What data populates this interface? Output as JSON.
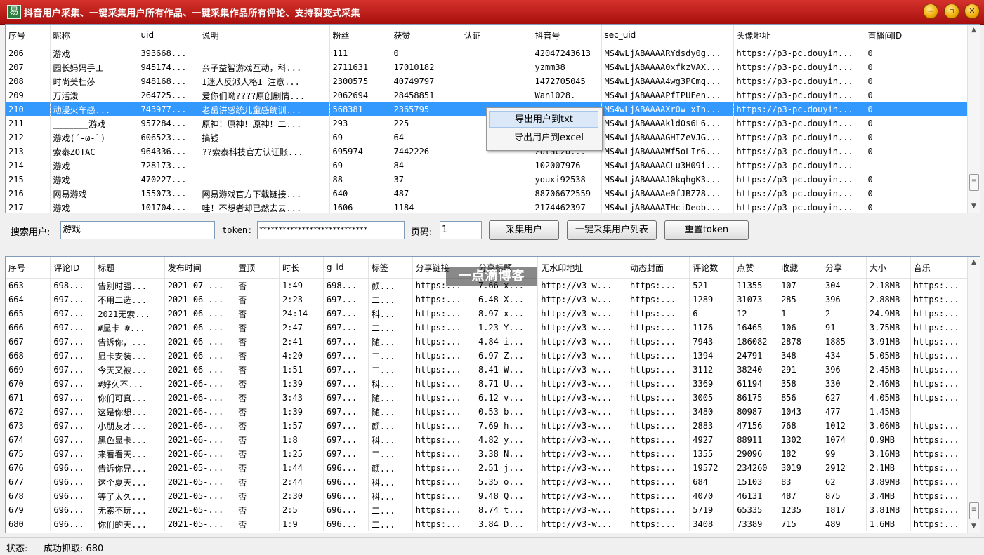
{
  "window": {
    "title": "抖音用户采集、一键采集用户所有作品、一键采集作品所有评论、支持裂变式采集",
    "icon": "app-icon"
  },
  "user_table": {
    "columns": [
      "序号",
      "昵称",
      "uid",
      "说明",
      "粉丝",
      "获赞",
      "认证",
      "抖音号",
      "sec_uid",
      "头像地址",
      "直播间ID"
    ],
    "rows": [
      [
        "206",
        "游戏",
        "393668...",
        "",
        "111",
        "0",
        "",
        "42047243613",
        "MS4wLjABAAAARYdsdy0g...",
        "https://p3-pc.douyin...",
        "0"
      ],
      [
        "207",
        "园长妈妈手工",
        "945174...",
        "亲子益智游戏互动，科...",
        "2711631",
        "17010182",
        "",
        "yzmm38",
        "MS4wLjABAAAA0xfkzVAX...",
        "https://p3-pc.douyin...",
        "0"
      ],
      [
        "208",
        "时尚美杜莎",
        "948168...",
        "I迷人反派人格I  注意...",
        "2300575",
        "40749797",
        "",
        "1472705045",
        "MS4wLjABAAAA4wg3PCmq...",
        "https://p3-pc.douyin...",
        "0"
      ],
      [
        "209",
        "万活泼",
        "264725...",
        "爱你们呦????原创剧情...",
        "2062694",
        "28458851",
        "",
        "Wan1028.",
        "MS4wLjABAAAAPfIPUFen...",
        "https://p3-pc.douyin...",
        "0"
      ],
      [
        "210",
        "动漫火车感...",
        "743977...",
        "老岳讲感统儿童感统训...",
        "568381",
        "2365795",
        "",
        "",
        "MS4wLjABAAAAXr0w_xIh...",
        "https://p3-pc.douyin...",
        "0"
      ],
      [
        "211",
        "_______游戏",
        "957284...",
        "原神！原神！原神！二...",
        "293",
        "225",
        "",
        "",
        "MS4wLjABAAAAkld0s6L6...",
        "https://p3-pc.douyin...",
        "0"
      ],
      [
        "212",
        "游戏(´-ω-`)",
        "606523...",
        "搞钱",
        "69",
        "64",
        "",
        "",
        "MS4wLjABAAAAGHIZeVJG...",
        "https://p3-pc.douyin...",
        "0"
      ],
      [
        "213",
        "索泰ZOTAC",
        "964336...",
        "??索泰科技官方认证账...",
        "695974",
        "7442226",
        "",
        "zotaczo...",
        "MS4wLjABAAAAWf5oLIr6...",
        "https://p3-pc.douyin...",
        "0"
      ],
      [
        "214",
        "游戏",
        "728173...",
        "",
        "69",
        "84",
        "",
        "102007976",
        "MS4wLjABAAAACLu3H09i...",
        "https://p3-pc.douyin...",
        ""
      ],
      [
        "215",
        "游戏",
        "470227...",
        "",
        "88",
        "37",
        "",
        "youxi92538",
        "MS4wLjABAAAAJ0kqhgK3...",
        "https://p3-pc.douyin...",
        "0"
      ],
      [
        "216",
        "网易游戏",
        "155073...",
        "网易游戏官方下载链接...",
        "640",
        "487",
        "",
        "88706672559",
        "MS4wLjABAAAAe0fJBZ78...",
        "https://p3-pc.douyin...",
        "0"
      ],
      [
        "217",
        "游戏",
        "101704...",
        "哇！不想者却已然去去...",
        "1606",
        "1184",
        "",
        "2174462397",
        "MS4wLjABAAAATHciDeob...",
        "https://p3-pc.douyin...",
        "0"
      ]
    ],
    "selected_row": 4
  },
  "context_menu": {
    "items": [
      "导出用户到txt",
      "导出用户到excel"
    ]
  },
  "search": {
    "user_label": "搜索用户:",
    "user_value": "游戏",
    "token_label": "token:",
    "token_value": "****************************",
    "page_label": "页码:",
    "page_value": "1",
    "btn_collect": "采集用户",
    "btn_collect_list": "一键采集用户列表",
    "btn_reset": "重置token"
  },
  "works_table": {
    "columns": [
      "序号",
      "评论ID",
      "标题",
      "发布时间",
      "置顶",
      "时长",
      "g_id",
      "标签",
      "分享链接",
      "分享标题",
      "无水印地址",
      "动态封面",
      "评论数",
      "点赞",
      "收藏",
      "分享",
      "大小",
      "音乐"
    ],
    "rows": [
      [
        "663",
        "698...",
        "告别时强...",
        "2021-07-...",
        "否",
        "1:49",
        "698...",
        "颜...",
        "https:...",
        "7.66 x...",
        "http://v3-w...",
        "https:...",
        "521",
        "11355",
        "107",
        "304",
        "2.18MB",
        "https:..."
      ],
      [
        "664",
        "697...",
        "不用二选...",
        "2021-06-...",
        "否",
        "2:23",
        "697...",
        "二...",
        "https:...",
        "6.48 X...",
        "http://v3-w...",
        "https:...",
        "1289",
        "31073",
        "285",
        "396",
        "2.88MB",
        "https:..."
      ],
      [
        "665",
        "697...",
        "2021无索...",
        "2021-06-...",
        "否",
        "24:14",
        "697...",
        "科...",
        "https:...",
        "8.97 x...",
        "http://v3-w...",
        "https:...",
        "6",
        "12",
        "1",
        "2",
        "24.9MB",
        "https:..."
      ],
      [
        "666",
        "697...",
        "#显卡 #...",
        "2021-06-...",
        "否",
        "2:47",
        "697...",
        "二...",
        "https:...",
        "1.23 Y...",
        "http://v3-w...",
        "https:...",
        "1176",
        "16465",
        "106",
        "91",
        "3.75MB",
        "https:..."
      ],
      [
        "667",
        "697...",
        "告诉你，...",
        "2021-06-...",
        "否",
        "2:41",
        "697...",
        "随...",
        "https:...",
        "4.84 i...",
        "http://v3-w...",
        "https:...",
        "7943",
        "186082",
        "2878",
        "1885",
        "3.91MB",
        "https:..."
      ],
      [
        "668",
        "697...",
        "显卡安装...",
        "2021-06-...",
        "否",
        "4:20",
        "697...",
        "二...",
        "https:...",
        "6.97 Z...",
        "http://v3-w...",
        "https:...",
        "1394",
        "24791",
        "348",
        "434",
        "5.05MB",
        "https:..."
      ],
      [
        "669",
        "697...",
        "今天又被...",
        "2021-06-...",
        "否",
        "1:51",
        "697...",
        "二...",
        "https:...",
        "8.41 W...",
        "http://v3-w...",
        "https:...",
        "3112",
        "38240",
        "291",
        "396",
        "2.45MB",
        "https:..."
      ],
      [
        "670",
        "697...",
        "#好久不...",
        "2021-06-...",
        "否",
        "1:39",
        "697...",
        "科...",
        "https:...",
        "8.71 U...",
        "http://v3-w...",
        "https:...",
        "3369",
        "61194",
        "358",
        "330",
        "2.46MB",
        "https:..."
      ],
      [
        "671",
        "697...",
        "你们可真...",
        "2021-06-...",
        "否",
        "3:43",
        "697...",
        "随...",
        "https:...",
        "6.12 v...",
        "http://v3-w...",
        "https:...",
        "3005",
        "86175",
        "856",
        "627",
        "4.05MB",
        "https:..."
      ],
      [
        "672",
        "697...",
        "这是你想...",
        "2021-06-...",
        "否",
        "1:39",
        "697...",
        "随...",
        "https:...",
        "0.53 b...",
        "http://v3-w...",
        "https:...",
        "3480",
        "80987",
        "1043",
        "477",
        "1.45MB",
        ""
      ],
      [
        "673",
        "697...",
        "小朋友才...",
        "2021-06-...",
        "否",
        "1:57",
        "697...",
        "颜...",
        "https:...",
        "7.69 h...",
        "http://v3-w...",
        "https:...",
        "2883",
        "47156",
        "768",
        "1012",
        "3.06MB",
        "https:..."
      ],
      [
        "674",
        "697...",
        "黑色显卡...",
        "2021-06-...",
        "否",
        "1:8",
        "697...",
        "科...",
        "https:...",
        "4.82 y...",
        "http://v3-w...",
        "https:...",
        "4927",
        "88911",
        "1302",
        "1074",
        "0.9MB",
        "https:..."
      ],
      [
        "675",
        "697...",
        "来看看天...",
        "2021-06-...",
        "否",
        "1:25",
        "697...",
        "二...",
        "https:...",
        "3.38 N...",
        "http://v3-w...",
        "https:...",
        "1355",
        "29096",
        "182",
        "99",
        "3.16MB",
        "https:..."
      ],
      [
        "676",
        "696...",
        "告诉你兄...",
        "2021-05-...",
        "否",
        "1:44",
        "696...",
        "颜...",
        "https:...",
        "2.51 j...",
        "http://v3-w...",
        "https:...",
        "19572",
        "234260",
        "3019",
        "2912",
        "2.1MB",
        "https:..."
      ],
      [
        "677",
        "696...",
        "这个夏天...",
        "2021-05-...",
        "否",
        "2:44",
        "696...",
        "科...",
        "https:...",
        "5.35 o...",
        "http://v3-w...",
        "https:...",
        "684",
        "15103",
        "83",
        "62",
        "3.89MB",
        "https:..."
      ],
      [
        "678",
        "696...",
        "等了太久...",
        "2021-05-...",
        "否",
        "2:30",
        "696...",
        "科...",
        "https:...",
        "9.48 Q...",
        "http://v3-w...",
        "https:...",
        "4070",
        "46131",
        "487",
        "875",
        "3.4MB",
        "https:..."
      ],
      [
        "679",
        "696...",
        "无索不玩...",
        "2021-05-...",
        "否",
        "2:5",
        "696...",
        "二...",
        "https:...",
        "8.74 t...",
        "http://v3-w...",
        "https:...",
        "5719",
        "65335",
        "1235",
        "1817",
        "3.81MB",
        "https:..."
      ],
      [
        "680",
        "696...",
        "你们的天...",
        "2021-05-...",
        "否",
        "1:9",
        "696...",
        "二...",
        "https:...",
        "3.84 D...",
        "http://v3-w...",
        "https:...",
        "3408",
        "73389",
        "715",
        "489",
        "1.6MB",
        "https:..."
      ]
    ]
  },
  "watermark": "一点滴博客",
  "status": {
    "label": "状态:",
    "text": "成功抓取: 680"
  }
}
